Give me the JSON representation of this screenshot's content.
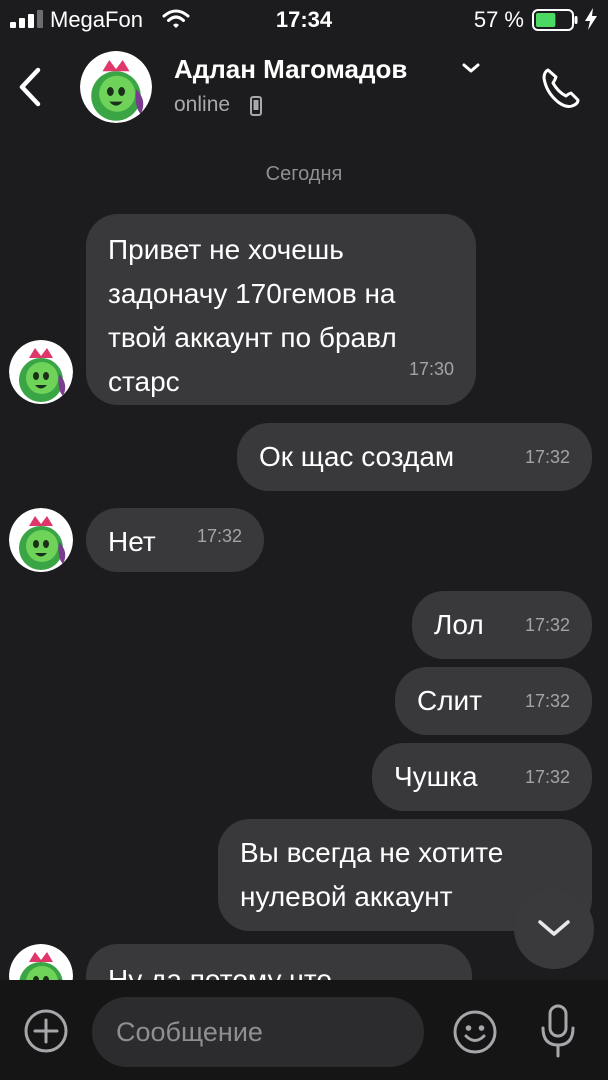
{
  "status_bar": {
    "carrier": "MegaFon",
    "time": "17:34",
    "battery_percent": "57 %",
    "battery_level": 0.57
  },
  "header": {
    "name": "Адлан Магомадов",
    "status": "online"
  },
  "date_separator": "Сегодня",
  "messages": [
    {
      "direction": "incoming",
      "text": "Привет не хочешь\nзадоначу 170гемов на\nтвой аккаунт по бравл\nстарс",
      "time": "17:30"
    },
    {
      "direction": "outgoing",
      "text": "Ок щас создам",
      "time": "17:32"
    },
    {
      "direction": "incoming",
      "text": "Нет",
      "time": "17:32"
    },
    {
      "direction": "outgoing",
      "text": "Лол",
      "time": "17:32"
    },
    {
      "direction": "outgoing",
      "text": "Слит",
      "time": "17:32"
    },
    {
      "direction": "outgoing",
      "text": "Чушка",
      "time": "17:32"
    },
    {
      "direction": "outgoing",
      "text": "Вы всегда не хотите\nнулевой аккаунт",
      "time": ""
    },
    {
      "direction": "incoming",
      "text": "Ну да потому что",
      "time": ""
    }
  ],
  "composer": {
    "placeholder": "Сообщение"
  },
  "icons": {
    "back": "chevron-left-icon",
    "call": "phone-icon",
    "scroll": "chevron-down-icon",
    "add": "plus-icon",
    "emoji": "smile-icon",
    "mic": "microphone-icon"
  },
  "colors": {
    "background": "#1c1c1e",
    "bubble": "#39393c",
    "battery": "#4cd964"
  }
}
